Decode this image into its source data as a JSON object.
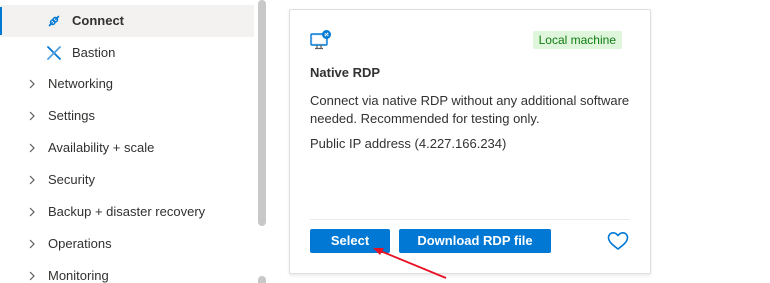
{
  "sidebar": {
    "items": [
      {
        "label": "Connect",
        "icon": "link-icon",
        "active": true
      },
      {
        "label": "Bastion",
        "icon": "bastion-icon"
      },
      {
        "label": "Networking"
      },
      {
        "label": "Settings"
      },
      {
        "label": "Availability + scale"
      },
      {
        "label": "Security"
      },
      {
        "label": "Backup + disaster recovery"
      },
      {
        "label": "Operations"
      },
      {
        "label": "Monitoring"
      }
    ]
  },
  "card": {
    "icon": "monitor-icon",
    "badge": "Local machine",
    "title": "Native RDP",
    "description": "Connect via native RDP without any additional software needed. Recommended for testing only.",
    "ip_text": "Public IP address (4.227.166.234)",
    "select_label": "Select",
    "download_label": "Download RDP file",
    "favorite_icon": "heart-icon"
  },
  "colors": {
    "accent": "#0078d4",
    "badge_bg": "#dff6dd",
    "badge_text": "#107c10",
    "annotation": "#e81123"
  }
}
